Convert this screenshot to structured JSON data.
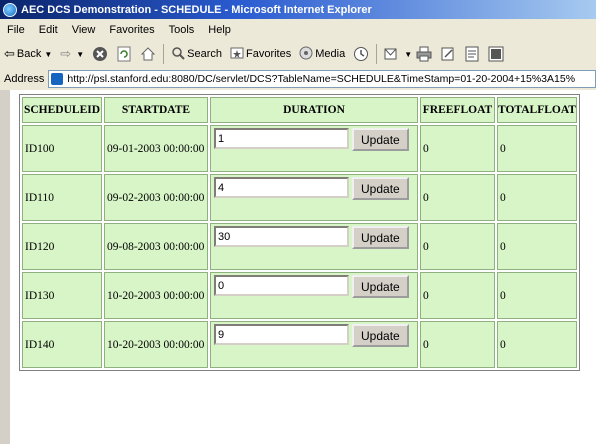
{
  "window": {
    "title": "AEC DCS Demonstration - SCHEDULE - Microsoft Internet Explorer"
  },
  "menu": [
    "File",
    "Edit",
    "View",
    "Favorites",
    "Tools",
    "Help"
  ],
  "toolbar": {
    "back_label": "Back",
    "search_label": "Search",
    "favorites_label": "Favorites",
    "media_label": "Media",
    "icons": [
      "back-arrow-icon",
      "forward-arrow-icon",
      "stop-icon",
      "refresh-icon",
      "home-icon",
      "search-icon",
      "favorites-icon",
      "media-icon",
      "history-icon",
      "mail-icon",
      "print-icon",
      "edit-icon",
      "discuss-icon",
      "messenger-icon"
    ]
  },
  "address": {
    "label": "Address",
    "url": "http://psl.stanford.edu:8080/DC/servlet/DCS?TableName=SCHEDULE&TimeStamp=01-20-2004+15%3A15%"
  },
  "table": {
    "headers": [
      "SCHEDULEID",
      "STARTDATE",
      "DURATION",
      "FREEFLOAT",
      "TOTALFLOAT"
    ],
    "update_label": "Update",
    "rows": [
      {
        "id": "ID100",
        "start": "09-01-2003 00:00:00",
        "duration": "1",
        "freefloat": "0",
        "totalfloat": "0"
      },
      {
        "id": "ID110",
        "start": "09-02-2003 00:00:00",
        "duration": "4",
        "freefloat": "0",
        "totalfloat": "0"
      },
      {
        "id": "ID120",
        "start": "09-08-2003 00:00:00",
        "duration": "30",
        "freefloat": "0",
        "totalfloat": "0"
      },
      {
        "id": "ID130",
        "start": "10-20-2003 00:00:00",
        "duration": "0",
        "freefloat": "0",
        "totalfloat": "0"
      },
      {
        "id": "ID140",
        "start": "10-20-2003 00:00:00",
        "duration": "9",
        "freefloat": "0",
        "totalfloat": "0"
      }
    ]
  },
  "colors": {
    "cell_bg": "#d8f5c8",
    "title_bar": "#0a246a",
    "chrome": "#ece9d8"
  }
}
